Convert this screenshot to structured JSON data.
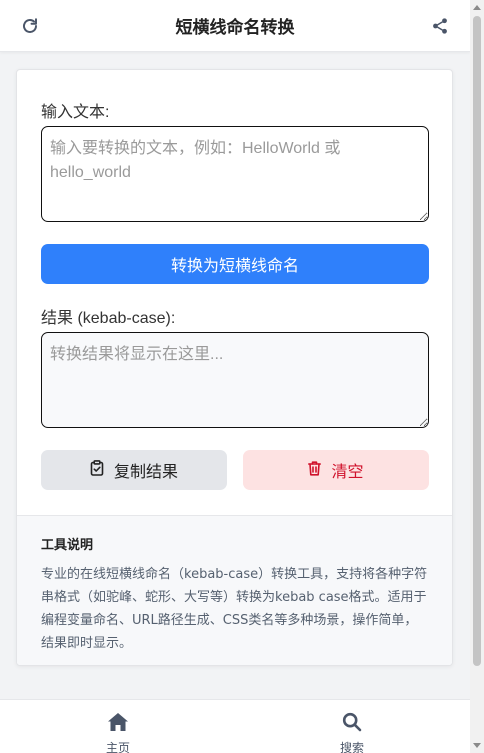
{
  "header": {
    "title": "短横线命名转换",
    "refresh_icon": "refresh-icon",
    "share_icon": "share-icon"
  },
  "form": {
    "input_label": "输入文本:",
    "input_placeholder": "输入要转换的文本，例如：HelloWorld 或 hello_world",
    "input_value": "",
    "convert_button": "转换为短横线命名",
    "result_label": "结果 (kebab-case):",
    "result_placeholder": "转换结果将显示在这里...",
    "result_value": "",
    "copy_button": "复制结果",
    "clear_button": "清空"
  },
  "description": {
    "title": "工具说明",
    "text": "专业的在线短横线命名（kebab-case）转换工具，支持将各种字符串格式（如驼峰、蛇形、大写等）转换为kebab case格式。适用于编程变量命名、URL路径生成、CSS类名等多种场景，操作简单，结果即时显示。"
  },
  "bottom_nav": {
    "items": [
      {
        "label": "主页",
        "icon": "home-icon"
      },
      {
        "label": "搜索",
        "icon": "search-icon"
      }
    ]
  },
  "colors": {
    "primary": "#2f80fb",
    "danger": "#d0112b",
    "danger_bg": "#fde2e2",
    "neutral_bg": "#e4e6ea",
    "icon": "#4a5568"
  }
}
